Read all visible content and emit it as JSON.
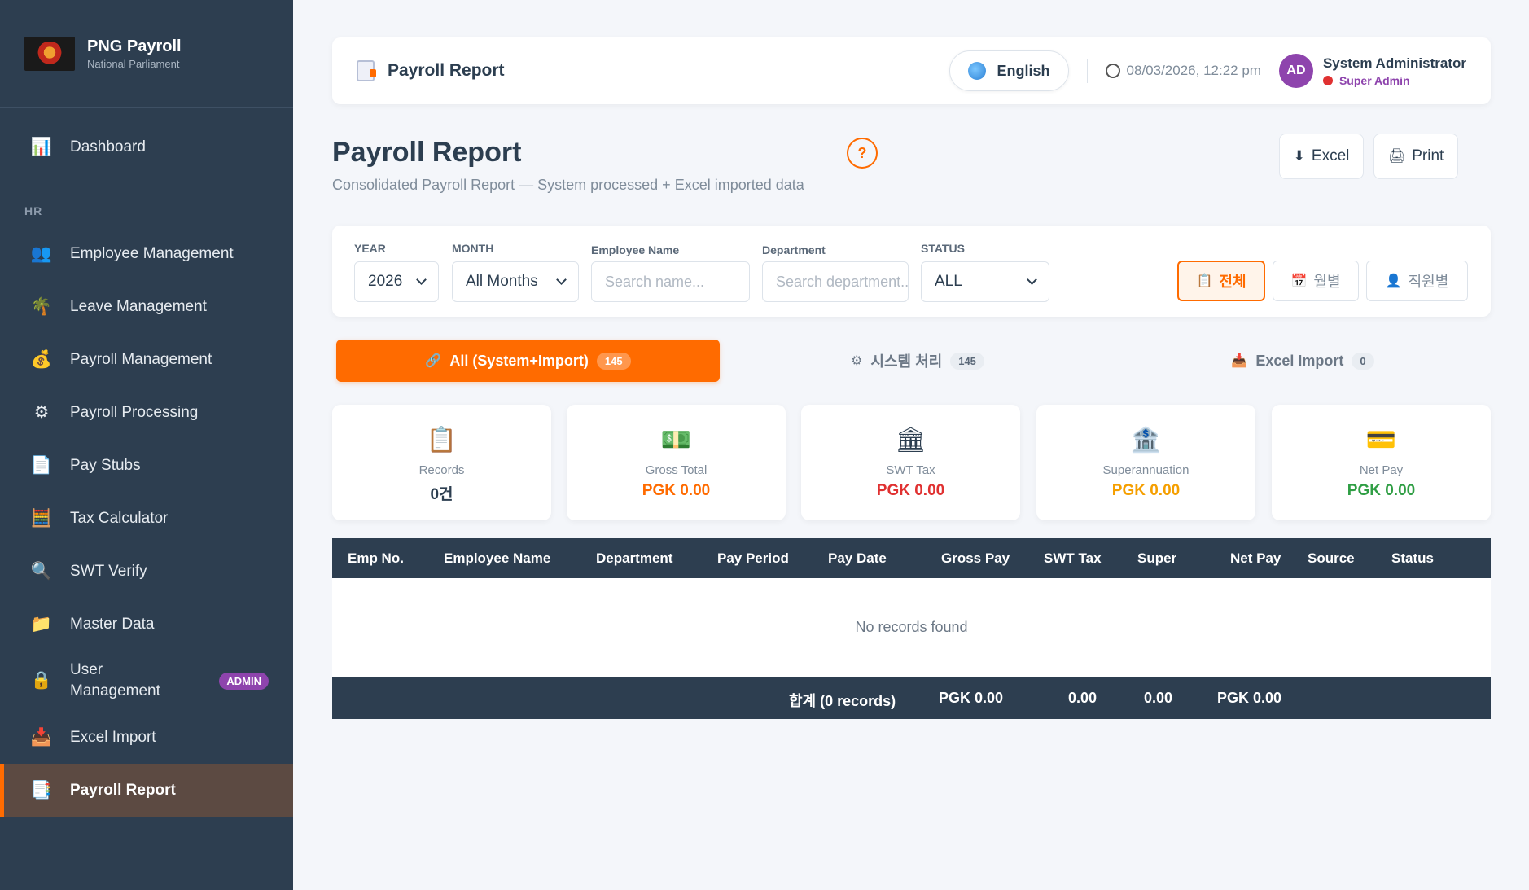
{
  "brand": {
    "title": "PNG Payroll",
    "subtitle": "National Parliament"
  },
  "sidebar": {
    "dashboard": "Dashboard",
    "section_hr": "HR",
    "items": [
      {
        "label": "Employee Management",
        "icon": "people-icon"
      },
      {
        "label": "Leave Management",
        "icon": "palm-tree-icon"
      },
      {
        "label": "Payroll Management",
        "icon": "money-bag-icon"
      },
      {
        "label": "Payroll Processing",
        "icon": "gear-icon"
      },
      {
        "label": "Pay Stubs",
        "icon": "document-icon"
      },
      {
        "label": "Tax Calculator",
        "icon": "calculator-icon"
      },
      {
        "label": "SWT Verify",
        "icon": "magnifier-icon"
      },
      {
        "label": "Master Data",
        "icon": "folder-icon"
      },
      {
        "label_line1": "User",
        "label_line2": "Management",
        "badge": "ADMIN",
        "icon": "lock-icon"
      },
      {
        "label": "Excel Import",
        "icon": "inbox-tray-icon"
      },
      {
        "label": "Payroll Report",
        "icon": "report-icon",
        "active": true
      }
    ]
  },
  "header": {
    "title": "Payroll Report",
    "language": "English",
    "datetime": "08/03/2026, 12:22 pm",
    "avatar_initials": "AD",
    "user_name": "System Administrator",
    "user_role": "Super Admin"
  },
  "page": {
    "title": "Payroll Report",
    "subtitle": "Consolidated Payroll Report — System processed + Excel imported data",
    "help": "?",
    "excel_label": "Excel",
    "print_label": "Print"
  },
  "filters": {
    "year_label": "YEAR",
    "year_value": "2026",
    "month_label": "MONTH",
    "month_value": "All Months",
    "employee_label": "Employee Name",
    "employee_placeholder": "Search name...",
    "department_label": "Department",
    "department_placeholder": "Search department...",
    "status_label": "STATUS",
    "status_value": "ALL",
    "views": [
      "전체",
      "월별",
      "직원별"
    ]
  },
  "source_tabs": [
    {
      "label": "All (System+Import)",
      "count": "145",
      "icon": "link-icon"
    },
    {
      "label": "시스템 처리",
      "count": "145",
      "icon": "gear-icon"
    },
    {
      "label": "Excel Import",
      "count": "0",
      "icon": "inbox-tray-icon"
    }
  ],
  "summary": [
    {
      "label": "Records",
      "value": "0건",
      "color": "#2c3e50",
      "icon": "clipboard-icon"
    },
    {
      "label": "Gross Total",
      "value": "PGK 0.00",
      "color": "#ff6b00",
      "icon": "cash-icon"
    },
    {
      "label": "SWT Tax",
      "value": "PGK 0.00",
      "color": "#e03131",
      "icon": "bank-icon"
    },
    {
      "label": "Superannuation",
      "value": "PGK 0.00",
      "color": "#f59f00",
      "icon": "bank-icon"
    },
    {
      "label": "Net Pay",
      "value": "PGK 0.00",
      "color": "#2f9e44",
      "icon": "credit-card-icon"
    }
  ],
  "table": {
    "columns": [
      "Emp No.",
      "Employee Name",
      "Department",
      "Pay Period",
      "Pay Date",
      "Gross Pay",
      "SWT Tax",
      "Super",
      "Net Pay",
      "Source",
      "Status"
    ],
    "empty_text": "No records found",
    "footer": {
      "total_label": "합계 (0 records)",
      "gross": "PGK 0.00",
      "swt": "0.00",
      "super": "0.00",
      "net": "PGK 0.00"
    }
  },
  "colors": {
    "accent": "#ff6b00",
    "sidebar": "#2d3e50",
    "admin_badge": "#8e44ad"
  }
}
